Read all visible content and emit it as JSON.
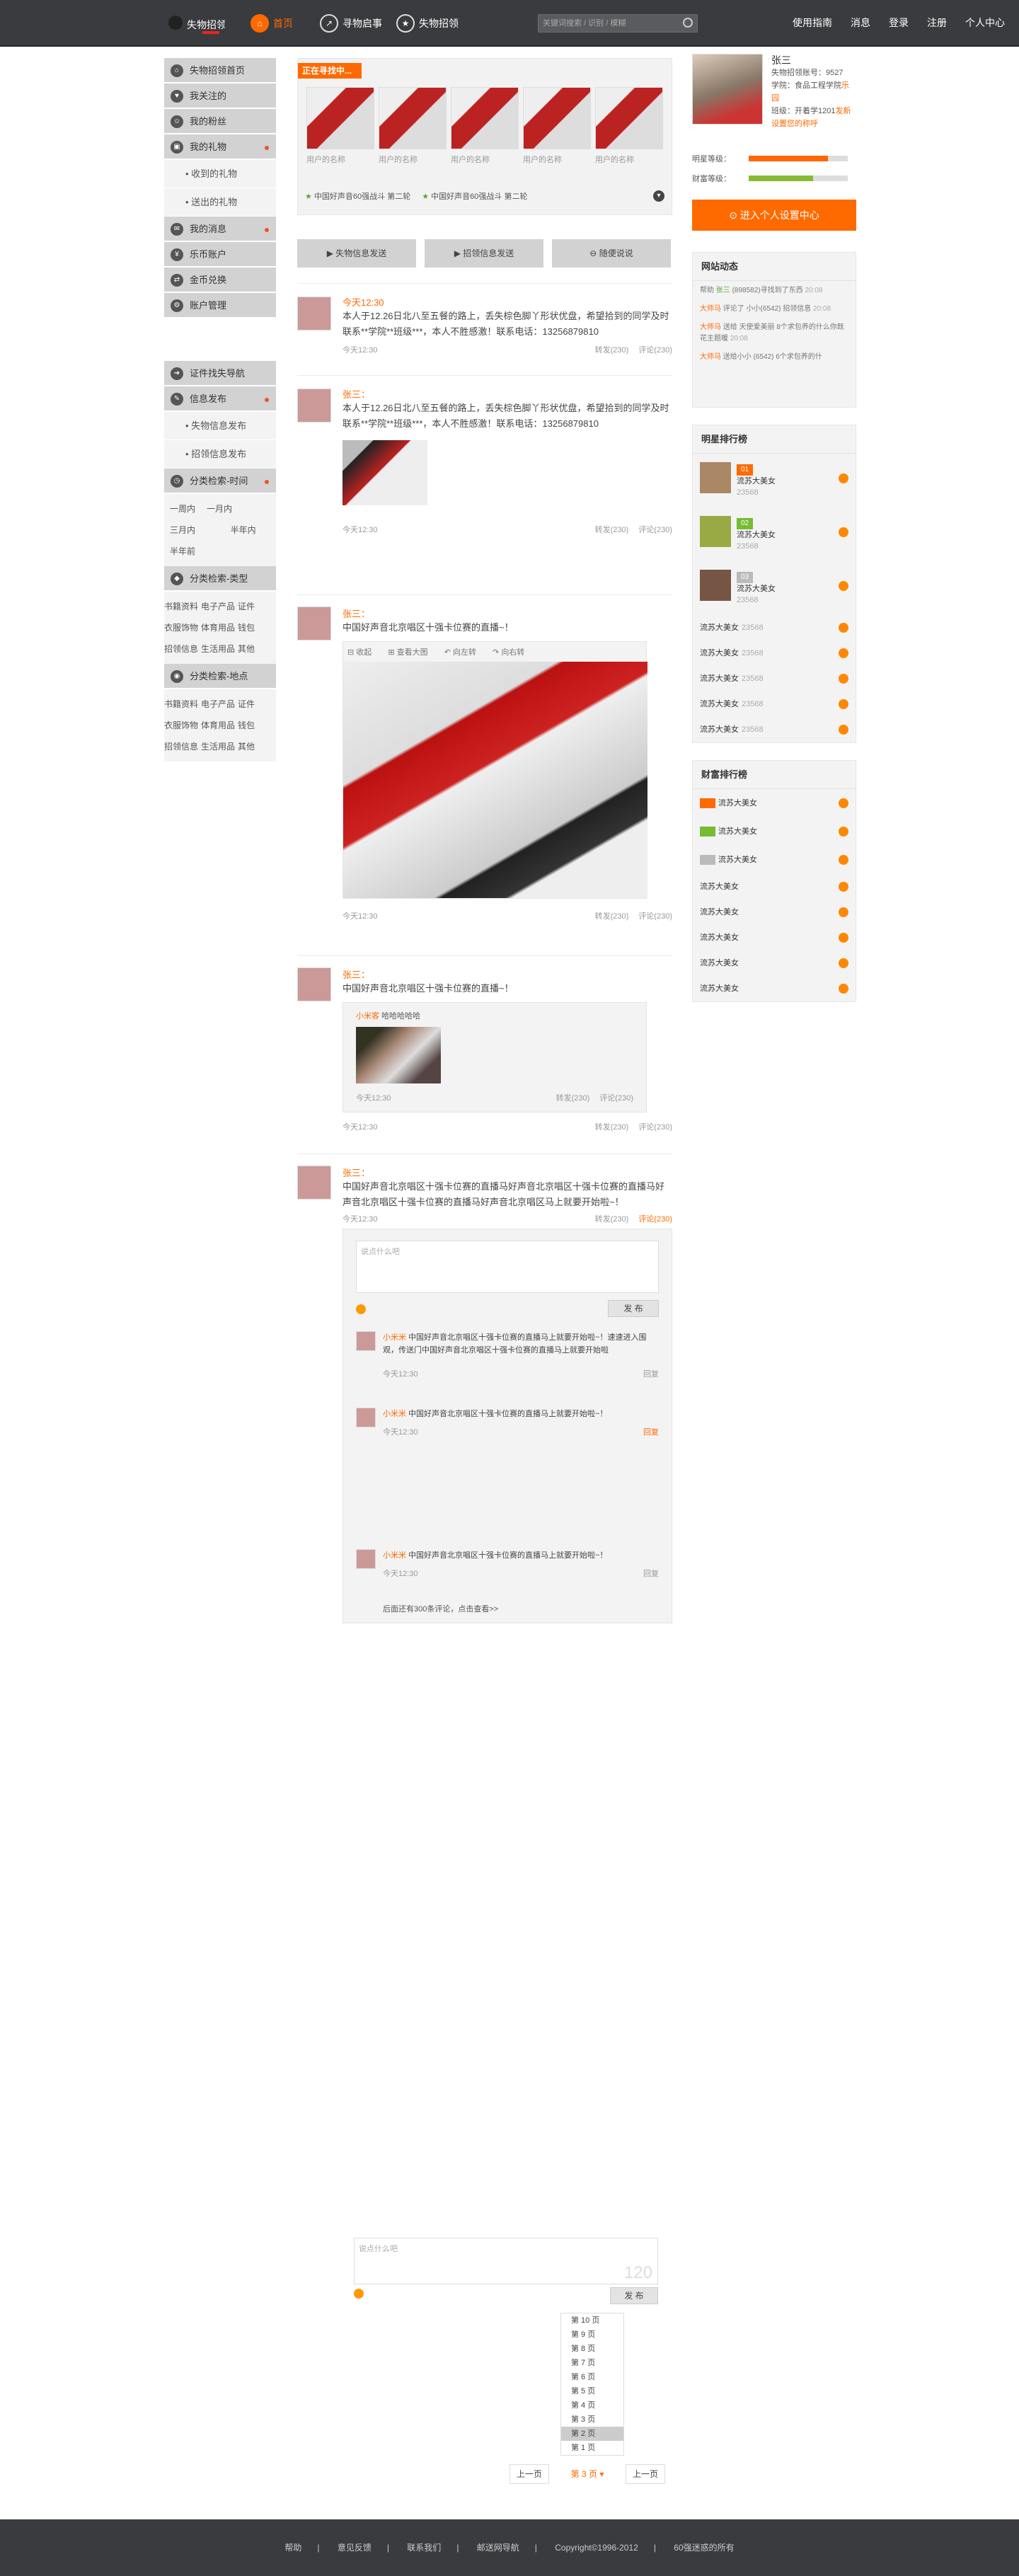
{
  "header": {
    "logo_text": "失物招领",
    "nav": [
      {
        "label": "首页"
      },
      {
        "label": "寻物启事"
      },
      {
        "label": "失物招领"
      }
    ],
    "search_placeholder": "关键词搜索 / 识别 / 模糊",
    "links": [
      "使用指南",
      "消息",
      "登录",
      "注册",
      "个人中心"
    ]
  },
  "sidebar": {
    "top": [
      "失物招领首页",
      "我关注的",
      "我的粉丝",
      "我的礼物"
    ],
    "gift_sub": [
      "收到的礼物",
      "送出的礼物"
    ],
    "mid": [
      "我的消息",
      "乐币账户",
      "金币兑换",
      "账户管理"
    ],
    "nav2": [
      "证件找失导航",
      "信息发布"
    ],
    "pub_sub": [
      "失物信息发布",
      "招领信息发布"
    ],
    "time_head": "分类检索-时间",
    "times": [
      "一周内",
      "一月内",
      "三月内",
      "半年内",
      "半年前"
    ],
    "type_head": "分类检索-类型",
    "types": [
      "书籍资料",
      "电子产品",
      "证件",
      "衣服饰物",
      "体育用品",
      "钱包",
      "招领信息",
      "生活用品",
      "其他"
    ],
    "place_head": "分类检索-地点",
    "places": [
      "书籍资料",
      "电子产品",
      "证件",
      "衣服饰物",
      "体育用品",
      "钱包",
      "招领信息",
      "生活用品",
      "其他"
    ]
  },
  "hunt": {
    "tag": "正在寻找中...",
    "items": [
      "用户的名称",
      "用户的名称",
      "用户的名称",
      "用户的名称",
      "用户的名称"
    ],
    "bottom": [
      "中国好声音60强战斗 第二轮",
      "中国好声音60强战斗 第二轮"
    ]
  },
  "actions": [
    "失物信息发送",
    "招领信息发送",
    "随便说说"
  ],
  "posts": [
    {
      "name": "今天12:30",
      "text": "本人于12.26日北八至五餐的路上，丢失棕色脚丫形状优盘，希望拾到的同学及时联系**学院**班级***，本人不胜感激！联系电话：13256879810",
      "time": "今天12:30",
      "fwd": "转发(230)",
      "cmt": "评论(230)"
    },
    {
      "name": "张三：",
      "text": "本人于12.26日北八至五餐的路上，丢失棕色脚丫形状优盘，希望拾到的同学及时联系**学院**班级***，本人不胜感激！联系电话：13256879810",
      "time": "今天12:30",
      "fwd": "转发(230)",
      "cmt": "评论(230)"
    },
    {
      "name": "张三：",
      "text": "中国好声音北京唱区十强卡位赛的直播~！",
      "time": "今天12:30",
      "fwd": "转发(230)",
      "cmt": "评论(230)",
      "tools": [
        "收起",
        "查看大图",
        "向左转",
        "向右转"
      ]
    },
    {
      "name": "张三：",
      "text": "中国好声音北京唱区十强卡位赛的直播~！",
      "time": "今天12:30",
      "fwd": "转发(230)",
      "cmt": "评论(230)",
      "quote_name": "小米客",
      "quote_text": "哈哈哈哈哈"
    },
    {
      "name": "张三：",
      "text": "中国好声音北京唱区十强卡位赛的直播马好声音北京唱区十强卡位赛的直播马好声音北京唱区十强卡位赛的直播马好声音北京唱区马上就要开始啦~！",
      "time": "今天12:30",
      "fwd": "转发(230)",
      "cmt": "评论(230)"
    }
  ],
  "comments": {
    "placeholder": "说点什么吧",
    "send": "发 布",
    "items": [
      {
        "name": "小米米",
        "text": "中国好声音北京唱区十强卡位赛的直播马上就要开始啦~！速速进入围观，传送门中国好声音北京唱区十强卡位赛的直播马上就要开始啦",
        "time": "今天12:30",
        "reply": "回复"
      },
      {
        "name": "小米米",
        "text": "中国好声音北京唱区十强卡位赛的直播马上就要开始啦~！",
        "time": "今天12:30",
        "reply": "回复"
      },
      {
        "name": "小米米",
        "text": "中国好声音北京唱区十强卡位赛的直播马上就要开始啦~！",
        "time": "今天12:30",
        "reply": "回复"
      }
    ],
    "more": "后面还有300条评论，点击查看>>"
  },
  "bottom_editor": {
    "placeholder": "说点什么吧",
    "count": "120",
    "send": "发 布"
  },
  "pager": {
    "pages": [
      "第 10 页",
      "第 9 页",
      "第 8 页",
      "第 7 页",
      "第 6 页",
      "第 5 页",
      "第 4 页",
      "第 3 页",
      "第 2 页",
      "第 1 页"
    ],
    "current": "第 3 页",
    "prev": "上一页",
    "next": "上一页"
  },
  "profile": {
    "name": "张三",
    "id_line": "失物招领账号：9527",
    "school": "学院：食品工程学院",
    "school_hl": "乐园",
    "class": "班级：开着学1201",
    "class_hl": "发新",
    "setting": "设置您的称呼",
    "star_label": "明星等级：",
    "wealth_label": "财富等级：",
    "btn": "进入个人设置中心"
  },
  "news": {
    "title": "网站动态",
    "items": [
      {
        "a": "帮助",
        "b": "张三",
        "c": "(898582)寻找到了东西",
        "t": "20:08"
      },
      {
        "a": "大师马",
        "b": "评论了",
        "c": "小小(6542) 招领信息",
        "t": "20:08"
      },
      {
        "a": "大师马",
        "b": "送给",
        "c": "天使爱美丽 8个求包养的什么你既花主题暖",
        "t": "20:08"
      },
      {
        "a": "大师马",
        "b": "送给小小",
        "c": "(6542) 6个求包养的什",
        "t": ""
      }
    ]
  },
  "star_rank": {
    "title": "明星排行榜",
    "items": [
      {
        "n": "01",
        "name": "流苏大美女",
        "g": "23568"
      },
      {
        "n": "02",
        "name": "流苏大美女",
        "g": "23568"
      },
      {
        "n": "03",
        "name": "流苏大美女",
        "g": "23568"
      },
      {
        "n": "",
        "name": "流苏大美女",
        "g": "23568"
      },
      {
        "n": "",
        "name": "流苏大美女",
        "g": "23568"
      },
      {
        "n": "",
        "name": "流苏大美女",
        "g": "23568"
      },
      {
        "n": "",
        "name": "流苏大美女",
        "g": "23568"
      },
      {
        "n": "",
        "name": "流苏大美女",
        "g": "23568"
      }
    ]
  },
  "wealth_rank": {
    "title": "财富排行榜",
    "items": [
      "流苏大美女",
      "流苏大美女",
      "流苏大美女",
      "流苏大美女",
      "流苏大美女",
      "流苏大美女",
      "流苏大美女",
      "流苏大美女"
    ]
  },
  "footer": [
    "帮助",
    "意见反馈",
    "联系我们",
    "邮送网导航",
    "Copyright©1996-2012",
    "60强迷惑的所有"
  ]
}
